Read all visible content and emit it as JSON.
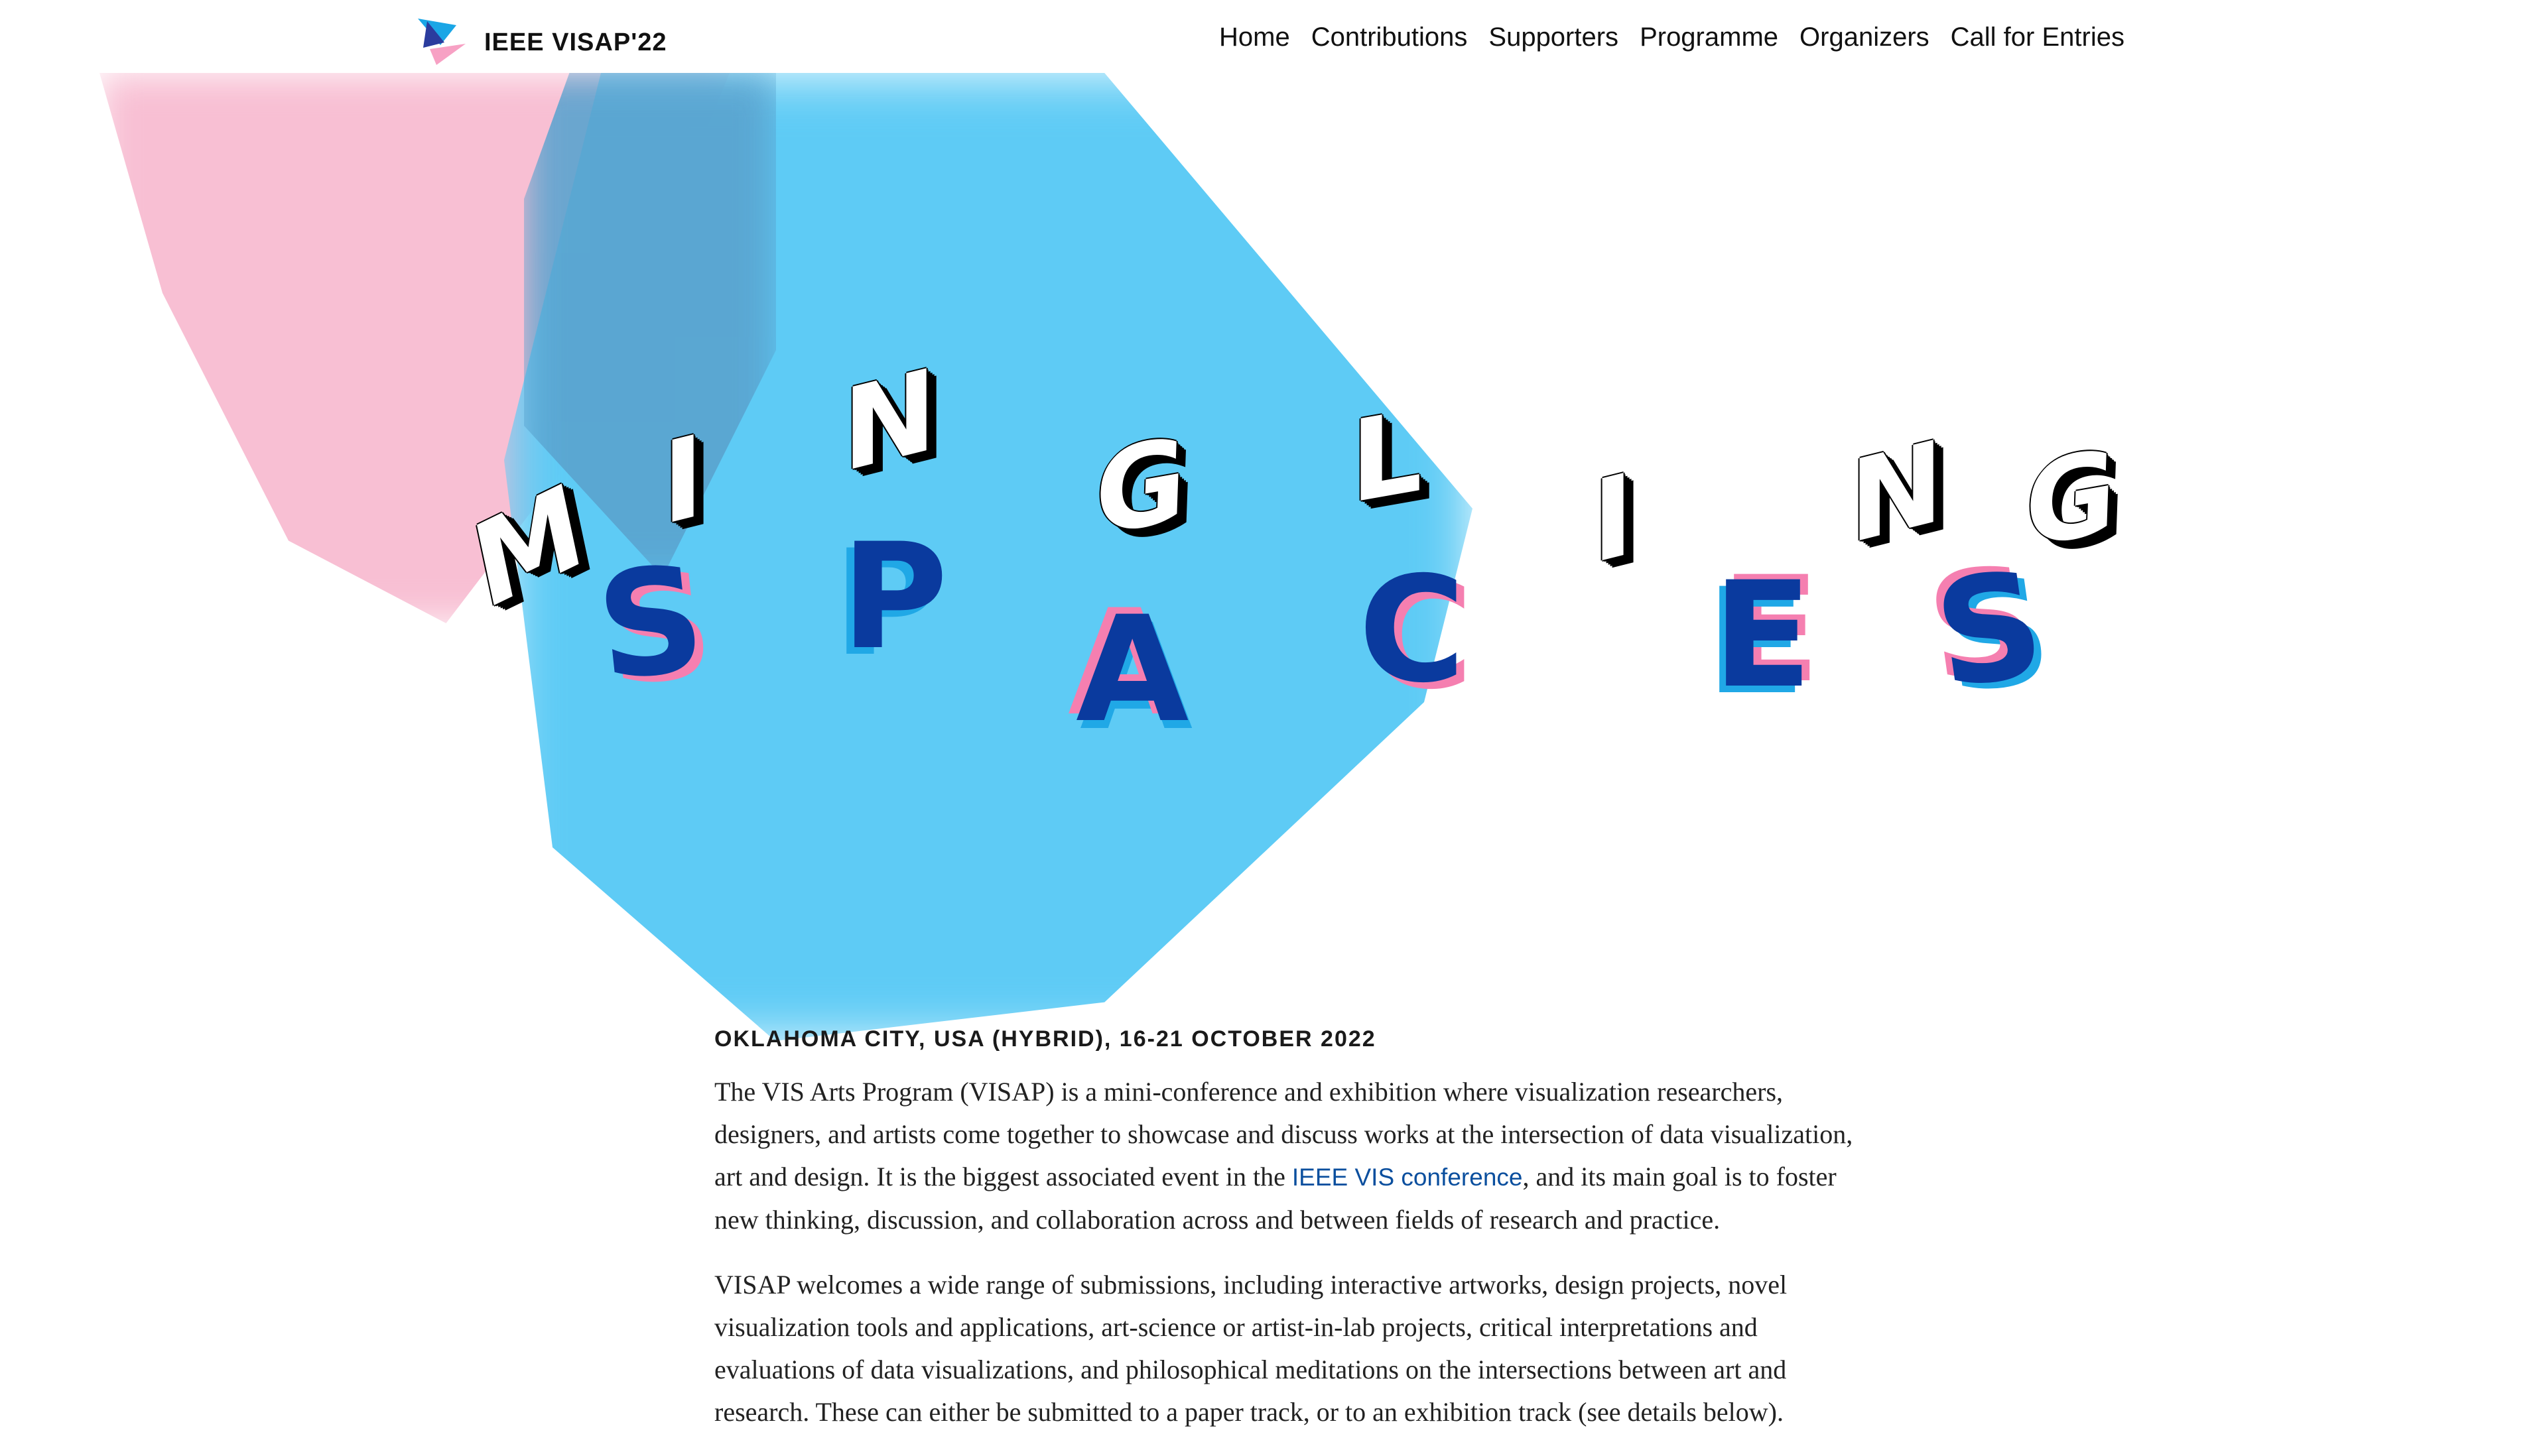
{
  "site": {
    "logo_text": "IEEE VISAP'22",
    "logo_icon": "visap-logo-icon"
  },
  "nav": {
    "items": [
      "Home",
      "Contributions",
      "Supporters",
      "Programme",
      "Organizers",
      "Call for Entries"
    ]
  },
  "hero": {
    "word1": [
      "M",
      "I",
      "N",
      "G",
      "L",
      "I",
      "N",
      "G"
    ],
    "word2": [
      "S",
      "P",
      "A",
      "C",
      "E",
      "S"
    ]
  },
  "content": {
    "location": "OKLAHOMA CITY, USA (HYBRID), 16-21 OCTOBER 2022",
    "para1_before": "The VIS Arts Program (VISAP) is a mini-conference and exhibition where visualization researchers, designers, and artists come together to showcase and discuss works at the intersection of data visualization, art and design. It is the biggest associated event in the ",
    "para1_link": "IEEE VIS conference",
    "para1_after": ", and its main goal is to foster new thinking, discussion, and collaboration across and between fields of research and practice.",
    "para2": "VISAP welcomes a wide range of submissions, including interactive artworks, design projects, novel visualization tools and applications, art-science or artist-in-lab projects, critical interpretations and evaluations of data visualizations, and philosophical meditations on the intersections between art and research. These can either be submitted to a paper track, or to an exhibition track (see details below)."
  },
  "colors": {
    "pink": "#f8bfd3",
    "blue": "#5ecbf5",
    "navy": "#0a3a9e",
    "accent_pink": "#f57fb0",
    "accent_blue": "#20a8e6",
    "link": "#0b4f9e"
  }
}
